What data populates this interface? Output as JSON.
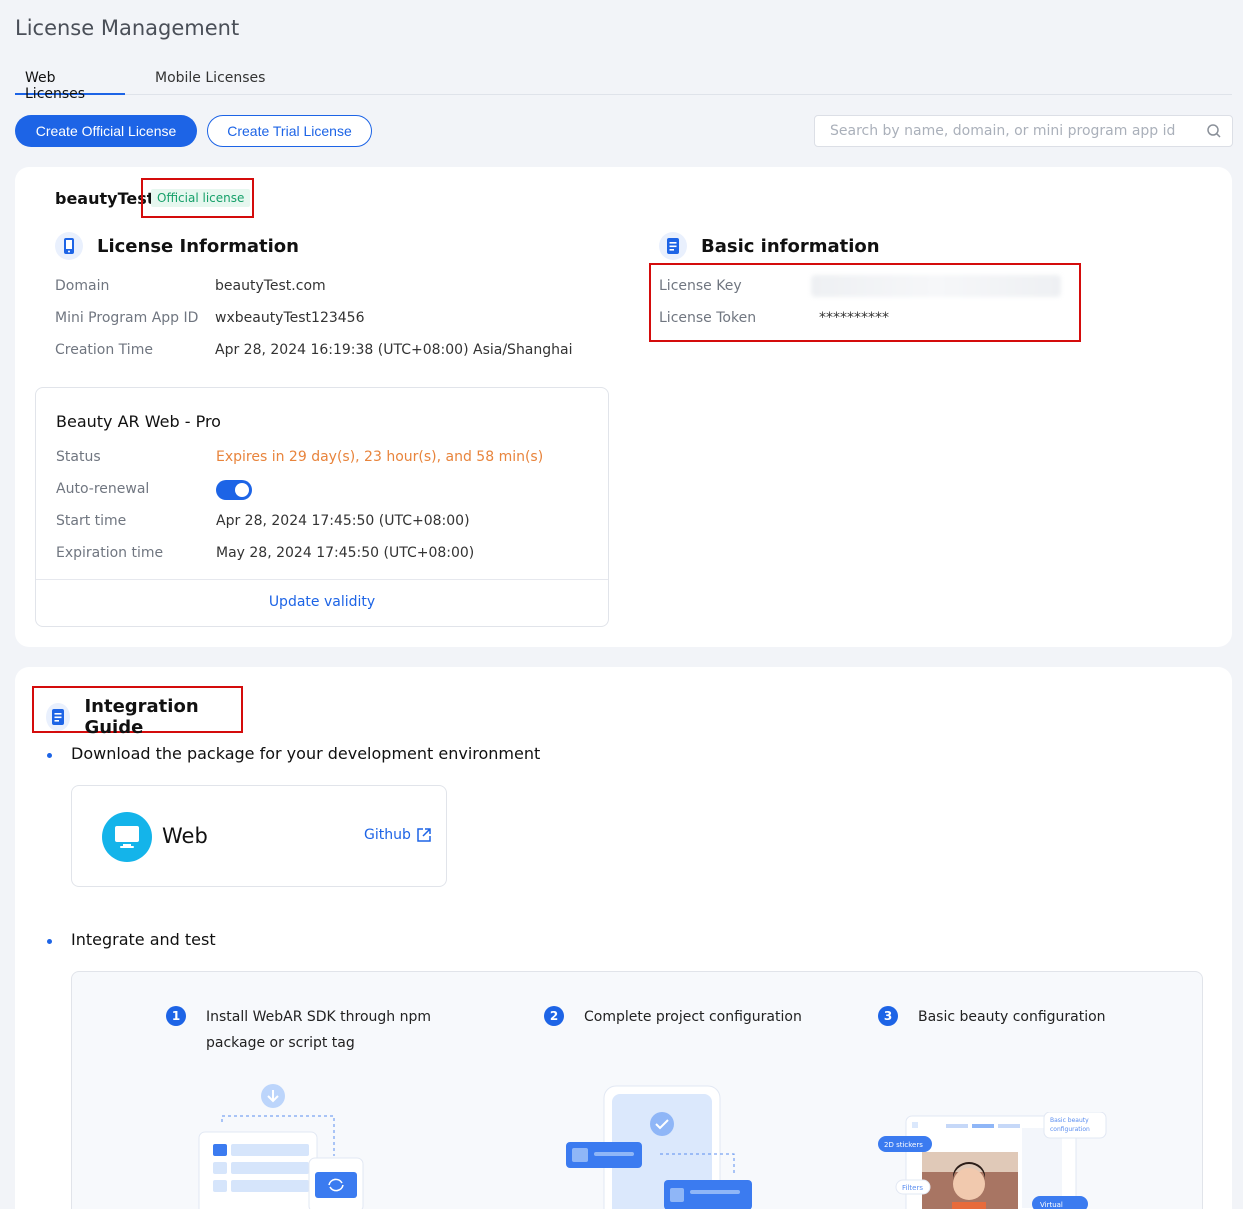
{
  "page": {
    "title": "License Management"
  },
  "tabs": [
    {
      "label": "Web Licenses",
      "active": true
    },
    {
      "label": "Mobile Licenses",
      "active": false
    }
  ],
  "toolbar": {
    "create_official_label": "Create Official License",
    "create_trial_label": "Create Trial License",
    "search_placeholder": "Search by name, domain, or mini program app id",
    "search_value": ""
  },
  "license": {
    "name": "beautyTest",
    "badge": "Official license",
    "license_info": {
      "title": "License Information",
      "icon": "phone-icon",
      "rows": [
        {
          "key": "Domain",
          "value": "beautyTest.com"
        },
        {
          "key": "Mini Program App ID",
          "value": "wxbeautyTest123456"
        },
        {
          "key": "Creation Time",
          "value": "Apr 28, 2024 16:19:38 (UTC+08:00) Asia/Shanghai"
        }
      ]
    },
    "basic_info": {
      "title": "Basic information",
      "icon": "document-icon",
      "rows": [
        {
          "key": "License Key",
          "value": ""
        },
        {
          "key": "License Token",
          "value": "**********"
        }
      ]
    },
    "product": {
      "title": "Beauty AR Web - Pro",
      "status_label": "Status",
      "status_value": "Expires in 29 day(s), 23 hour(s), and 58 min(s)",
      "status_color": "#e8843c",
      "auto_renewal_label": "Auto-renewal",
      "auto_renewal_on": true,
      "start_label": "Start time",
      "start_value": "Apr 28, 2024 17:45:50 (UTC+08:00)",
      "expiration_label": "Expiration time",
      "expiration_value": "May 28, 2024 17:45:50 (UTC+08:00)",
      "update_label": "Update validity"
    }
  },
  "guide": {
    "title": "Integration Guide",
    "download_heading": "Download the package for your development environment",
    "platform": {
      "label": "Web",
      "icon": "monitor-icon",
      "link_label": "Github"
    },
    "integrate_heading": "Integrate and test",
    "steps": [
      {
        "num": "1",
        "text": "Install WebAR SDK through npm package or script tag"
      },
      {
        "num": "2",
        "text": "Complete project configuration"
      },
      {
        "num": "3",
        "text": "Basic beauty configuration"
      }
    ],
    "illustration_labels": {
      "stickers": "2D stickers",
      "filters": "Filters",
      "basic_beauty": "Basic beauty configuration",
      "virtual": "Virtual"
    }
  },
  "colors": {
    "accent": "#1d64e6",
    "badge_text": "#16a06a",
    "badge_bg": "#e6f7ef",
    "highlight_border": "#d40c0c"
  }
}
